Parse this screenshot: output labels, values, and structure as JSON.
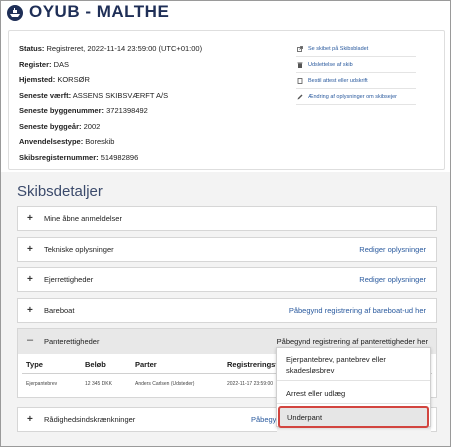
{
  "header": {
    "title": "OYUB - MALTHE"
  },
  "info": {
    "status_label": "Status:",
    "status_value": " Registreret, 2022-11-14 23:59:00 (UTC+01:00)",
    "register_label": "Register:",
    "register_value": " DAS",
    "hjemsted_label": "Hjemsted:",
    "hjemsted_value": " KORSØR",
    "vaerft_label": "Seneste værft:",
    "vaerft_value": " ASSENS SKIBSVÆRFT A/S",
    "byggenr_label": "Seneste byggenummer:",
    "byggenr_value": " 3721398492",
    "byggeaar_label": "Seneste byggeår:",
    "byggeaar_value": " 2002",
    "anvendelse_label": "Anvendelsestype:",
    "anvendelse_value": " Boreskib",
    "skibsreg_label": "Skibsregisternummer:",
    "skibsreg_value": " 514982896"
  },
  "side_links": [
    {
      "label": "Se skibet på Skibsbladet",
      "icon": "external-link-icon"
    },
    {
      "label": "Udslettelse af skib",
      "icon": "trash-icon"
    },
    {
      "label": "Bestil attest eller udskrift",
      "icon": "document-icon"
    },
    {
      "label": "Ændring af oplysninger om skibsejer",
      "icon": "pencil-icon"
    }
  ],
  "details": {
    "title": "Skibsdetaljer",
    "rows": [
      {
        "sign": "+",
        "label": "Mine åbne anmeldelser",
        "action": ""
      },
      {
        "sign": "+",
        "label": "Tekniske oplysninger",
        "action": "Rediger oplysninger"
      },
      {
        "sign": "+",
        "label": "Ejerrettigheder",
        "action": "Rediger oplysninger"
      },
      {
        "sign": "+",
        "label": "Bareboat",
        "action": "Påbegynd registrering af bareboat-ud her"
      }
    ],
    "panteret": {
      "sign": "–",
      "label": "Panterettigheder",
      "action": "Påbegynd registrering af panterettigheder her",
      "columns": [
        "Type",
        "Beløb",
        "Parter",
        "Registreringst"
      ],
      "row": [
        "Ejerpantebrev",
        "12 345 DKK",
        "Anders Carlsen (Udsteder)",
        "2022-11-17 23:59:00"
      ]
    },
    "raadighed": {
      "sign": "+",
      "label": "Rådighedsindskrænkninger",
      "action": "Påbegyn"
    }
  },
  "dropdown": {
    "item1_line1": "Ejerpantebrev, pantebrev eller",
    "item1_line2": "skadesløsbrev",
    "item2": "Arrest eller udlæg",
    "item3": "Underpant"
  },
  "colors": {
    "brand": "#1f2f57",
    "link": "#2a5a9e",
    "highlight_border": "#d2453f"
  }
}
